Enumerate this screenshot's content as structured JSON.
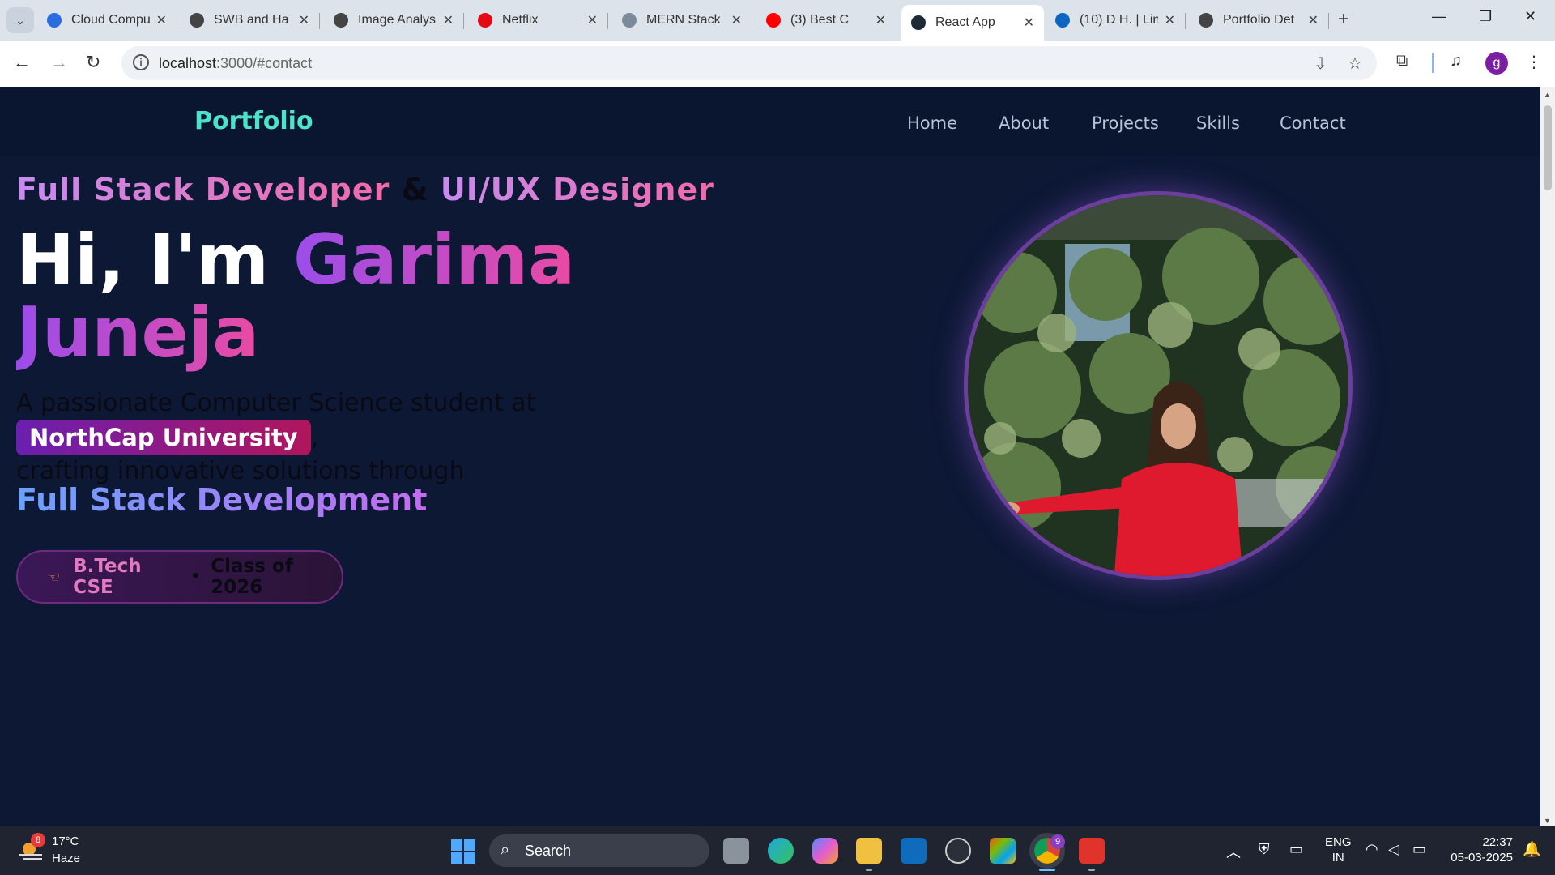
{
  "browser": {
    "tabs": [
      {
        "title": "Cloud Compu",
        "icon": "s-logo-icon",
        "color": "#2a6de0"
      },
      {
        "title": "SWB and Ha",
        "icon": "openai-icon",
        "color": "#444444"
      },
      {
        "title": "Image Analys",
        "icon": "openai-icon",
        "color": "#444444"
      },
      {
        "title": "Netflix",
        "icon": "netflix-icon",
        "color": "#e50914"
      },
      {
        "title": "MERN Stack",
        "icon": "mern-icon",
        "color": "#7a8a9a"
      },
      {
        "title": "(3) Best C",
        "icon": "youtube-icon",
        "color": "#ff0000"
      },
      {
        "title": "React App",
        "icon": "react-icon",
        "color": "#1f2a37"
      },
      {
        "title": "(10) D H. | Lin",
        "icon": "linkedin-icon",
        "color": "#0a66c2"
      },
      {
        "title": "Portfolio Det",
        "icon": "openai-icon",
        "color": "#444444"
      }
    ],
    "active_tab": 6,
    "url_host": "localhost",
    "url_rest": ":3000/#contact",
    "profile_initial": "g"
  },
  "site": {
    "logo": "Portfolio",
    "nav": [
      "Home",
      "About",
      "Projects",
      "Skills",
      "Contact"
    ],
    "role_left": "Full Stack Developer",
    "role_amp": "&",
    "role_right": "UI/UX Designer",
    "hero_greeting": "Hi, I'm",
    "hero_first": "Garima",
    "hero_last": "Juneja",
    "desc_before": "A passionate Computer Science student at",
    "university": "NorthCap University",
    "desc_after_comma": ",",
    "desc_line2": "crafting innovative solutions through",
    "focus": "Full Stack Development",
    "badge_degree": "B.Tech CSE",
    "badge_dot": "•",
    "badge_class": "Class of 2026"
  },
  "taskbar": {
    "weather_badge": "8",
    "temperature": "17°C",
    "condition": "Haze",
    "search_label": "Search",
    "chrome_badge": "9",
    "lang_top": "ENG",
    "lang_bottom": "IN",
    "time": "22:37",
    "date": "05-03-2025"
  }
}
